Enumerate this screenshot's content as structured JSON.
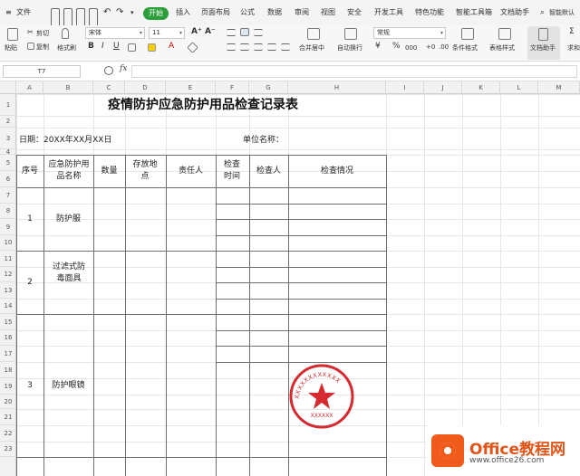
{
  "menubar": {
    "hamburger": "≡",
    "file": "文件",
    "tabs": [
      "开始",
      "插入",
      "页面布局",
      "公式",
      "数据",
      "审阅",
      "视图",
      "安全",
      "开发工具",
      "特色功能",
      "智能工具箱",
      "文档助手"
    ],
    "search": "智能默认"
  },
  "ribbon": {
    "paste": "粘贴",
    "cut": "剪切",
    "copy": "复制",
    "format_painter": "格式刷",
    "font_name": "宋体",
    "font_size": "11",
    "bold": "B",
    "italic": "I",
    "underline": "U",
    "grow_font": "A⁺",
    "shrink_font": "A⁻",
    "merge_center": "合并居中",
    "wrap_text": "自动换行",
    "number_format": "常规",
    "currency": "¥",
    "percent": "%",
    "thousands": "000",
    "conditional_format": "条件格式",
    "table_style": "表格样式",
    "doc_helper": "文档助手",
    "sum": "求和"
  },
  "formula_bar": {
    "name_box": "T7",
    "fx": "fx",
    "value": ""
  },
  "columns": [
    "A",
    "B",
    "C",
    "D",
    "E",
    "F",
    "G",
    "H",
    "I",
    "J",
    "K",
    "L",
    "M"
  ],
  "rows": [
    "1",
    "2",
    "3",
    "4",
    "5",
    "6",
    "7",
    "8",
    "9",
    "10",
    "11",
    "12",
    "13",
    "14",
    "15",
    "16",
    "17",
    "18",
    "19",
    "20",
    "21",
    "22",
    "23"
  ],
  "sheet": {
    "title": "疫情防护应急防护用品检查记录表",
    "date_label": "日期：20XX年XX月XX日",
    "unit_label": "单位名称：",
    "headers": [
      "序号",
      "应急防护用品名称",
      "数量",
      "存放地点",
      "责任人",
      "检查时间",
      "检查人",
      "检查情况"
    ],
    "items": [
      {
        "no": "1",
        "name": "防护服"
      },
      {
        "no": "2",
        "name": "过滤式防毒面具"
      },
      {
        "no": "3",
        "name": "防护眼镜"
      }
    ],
    "stamp_text": "XXXXXXXXXXXX",
    "stamp_bottom": "XXXXXX"
  },
  "watermark": {
    "brand": "Office教程网",
    "url": "www.office26.com"
  },
  "colors": {
    "start_tab": "#2c9f3a",
    "stamp": "#d42a30",
    "watermark": "#e25418"
  }
}
